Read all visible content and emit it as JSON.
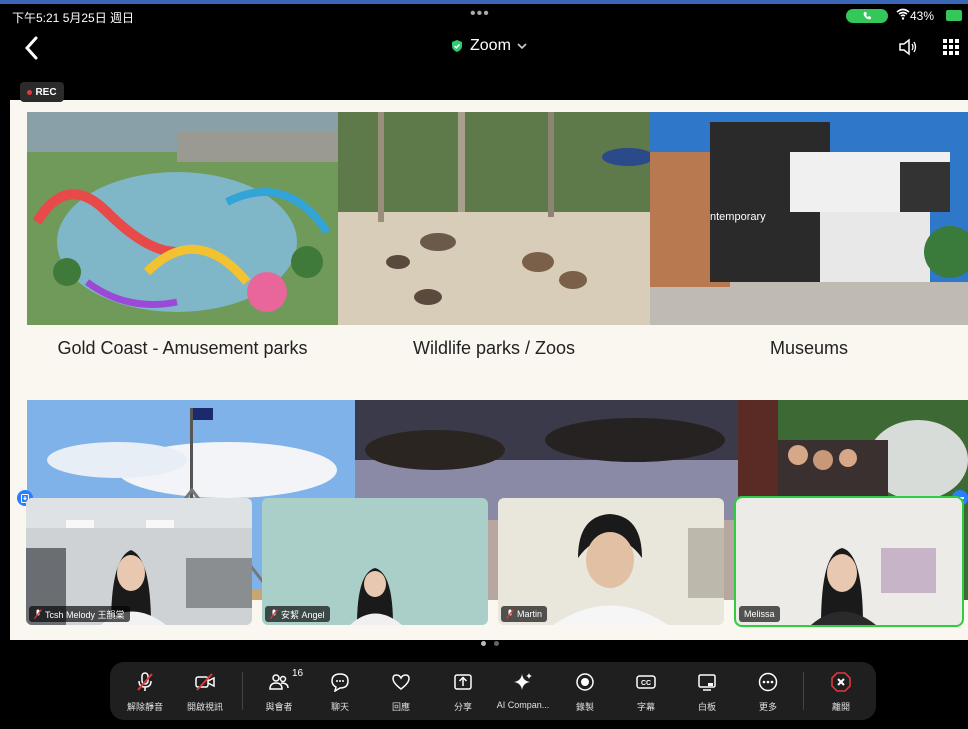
{
  "status": {
    "time": "下午5:21  5月25日 週日",
    "battery": "43%"
  },
  "header": {
    "title": "Zoom"
  },
  "rec_label": "REC",
  "slide": {
    "captions": [
      "Gold Coast - Amusement parks",
      "Wildlife parks / Zoos",
      "Museums"
    ],
    "museum_sign": "ntemporary"
  },
  "participants": [
    {
      "name": "Tcsh Melody 王韻棠"
    },
    {
      "name": "安絜 Angel"
    },
    {
      "name": "Martin"
    },
    {
      "name": "Melissa"
    }
  ],
  "toolbar": {
    "unmute": "解除靜音",
    "video": "開啟視訊",
    "participants": "與會者",
    "participants_count": "16",
    "chat": "聊天",
    "react": "回應",
    "share": "分享",
    "ai": "AI Compan...",
    "record": "錄製",
    "captions": "字幕",
    "whiteboard": "白板",
    "more": "更多",
    "leave": "離開"
  },
  "colors": {
    "accent_green": "#34c759",
    "leave_red": "#e0383a",
    "active_border": "#2ecc40"
  }
}
